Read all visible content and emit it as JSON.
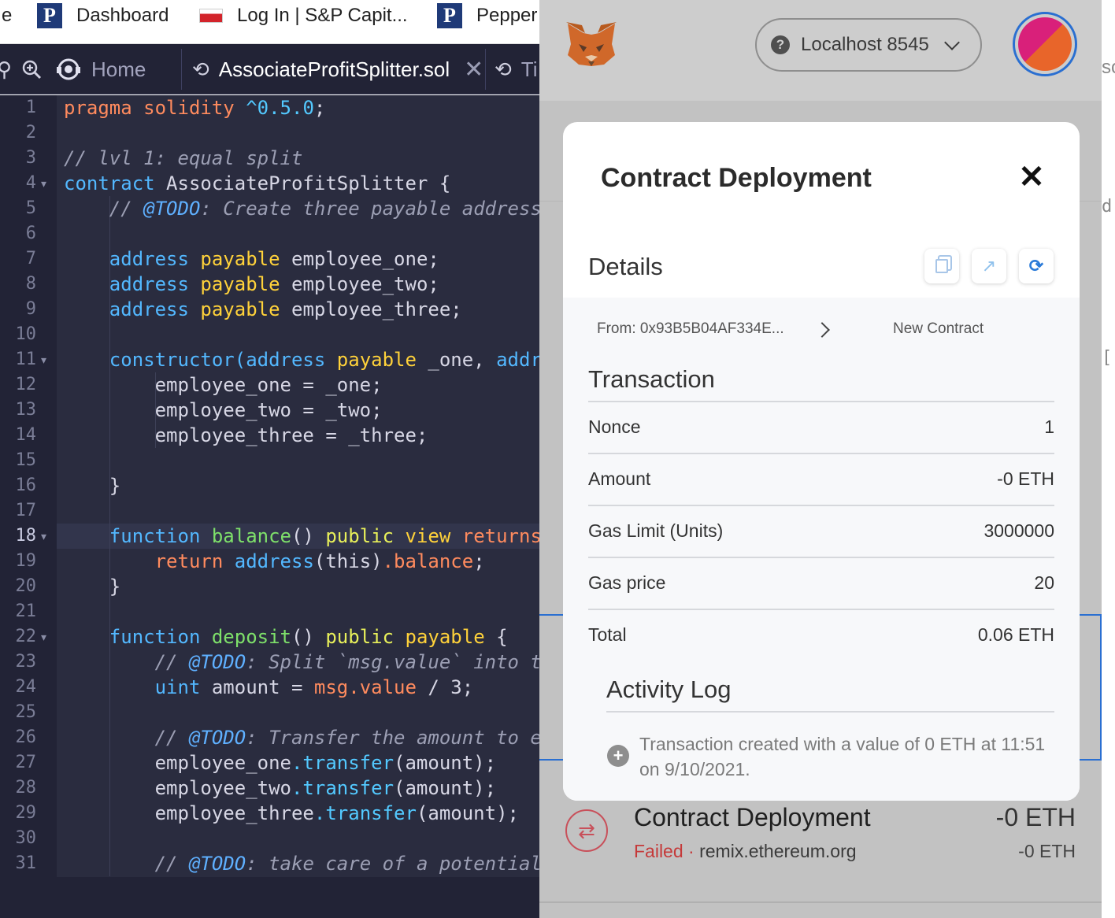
{
  "bookmarks": {
    "edge_fragment": "e",
    "items": [
      {
        "label": "Dashboard",
        "icon": "p-logo-icon"
      },
      {
        "label": "Log In | S&P Capit...",
        "icon": "flag-icon"
      },
      {
        "label": "Pepper",
        "icon": "p-logo-icon"
      }
    ]
  },
  "editor": {
    "tabs": {
      "home": "Home",
      "active_file": "AssociateProfitSplitter.sol",
      "other_file": "Ti"
    },
    "right_fragments": {
      "r5": "d",
      "r11": "[",
      "tab": "so"
    },
    "line_numbers": [
      "1",
      "2",
      "3",
      "4",
      "5",
      "6",
      "7",
      "8",
      "9",
      "10",
      "11",
      "12",
      "13",
      "14",
      "15",
      "16",
      "17",
      "18",
      "19",
      "20",
      "21",
      "22",
      "23",
      "24",
      "25",
      "26",
      "27",
      "28",
      "29",
      "30",
      "31"
    ],
    "lines": {
      "l1": {
        "a": "pragma solidity",
        "b": " ^0.5.0",
        "c": ";"
      },
      "l3": "// lvl 1: equal split",
      "l4": {
        "a": "contract",
        "b": " AssociateProfitSplitter {"
      },
      "l5": {
        "a": "    // ",
        "b": "@TODO",
        "c": ": Create three payable address"
      },
      "l7": {
        "a": "    address",
        "b": " payable",
        "c": " employee_one;"
      },
      "l8": {
        "a": "    address",
        "b": " payable",
        "c": " employee_two;"
      },
      "l9": {
        "a": "    address",
        "b": " payable",
        "c": " employee_three;"
      },
      "l11": {
        "a": "    constructor(",
        "b": "address",
        "c": " payable",
        "d": " _one, ",
        "e": "addr"
      },
      "l12": "        employee_one = _one;",
      "l13": "        employee_two = _two;",
      "l14": "        employee_three = _three;",
      "l16": "    }",
      "l18": {
        "a": "    function",
        "b": " balance",
        "c": "() ",
        "d": "public",
        "e": " view",
        "f": " returns"
      },
      "l19": {
        "a": "        return",
        "b": " address",
        "c": "(this)",
        "d": ".balance",
        "e": ";"
      },
      "l20": "    }",
      "l22": {
        "a": "    function",
        "b": " deposit",
        "c": "() ",
        "d": "public",
        "e": " payable",
        "f": " {"
      },
      "l23": {
        "a": "        // ",
        "b": "@TODO",
        "c": ": Split `msg.value` into t"
      },
      "l24": {
        "a": "        uint",
        "b": " amount = ",
        "c": "msg.value",
        "d": " / 3;"
      },
      "l26": {
        "a": "        // ",
        "b": "@TODO",
        "c": ": Transfer the amount to e"
      },
      "l27": {
        "a": "        employee_one",
        "b": ".transfer",
        "c": "(amount);"
      },
      "l28": {
        "a": "        employee_two",
        "b": ".transfer",
        "c": "(amount);"
      },
      "l29": {
        "a": "        employee_three",
        "b": ".transfer",
        "c": "(amount);"
      },
      "l31": {
        "a": "        // ",
        "b": "@TODO",
        "c": ": take care of a potential"
      }
    }
  },
  "metamask": {
    "network": "Localhost 8545",
    "colors": {
      "accent": "#2a6fd1",
      "failed": "#c53a3a"
    },
    "modal": {
      "title": "Contract Deployment",
      "close": "✕",
      "details_label": "Details",
      "from": "From: 0x93B5B04AF334E...",
      "to": "New Contract",
      "transaction_heading": "Transaction",
      "rows": [
        {
          "label": "Nonce",
          "value": "1"
        },
        {
          "label": "Amount",
          "value": "-0 ETH"
        },
        {
          "label": "Gas Limit (Units)",
          "value": "3000000"
        },
        {
          "label": "Gas price",
          "value": "20"
        },
        {
          "label": "Total",
          "value": "0.06 ETH"
        }
      ],
      "activity_heading": "Activity Log",
      "activity_entry": "Transaction created with a value of 0 ETH at 11:51 on 9/10/2021."
    },
    "activity": {
      "title": "Contract Deployment",
      "status": "Failed",
      "separator": " · ",
      "origin": "remix.ethereum.org",
      "amount": "-0 ETH",
      "amount_secondary": "-0 ETH"
    }
  }
}
